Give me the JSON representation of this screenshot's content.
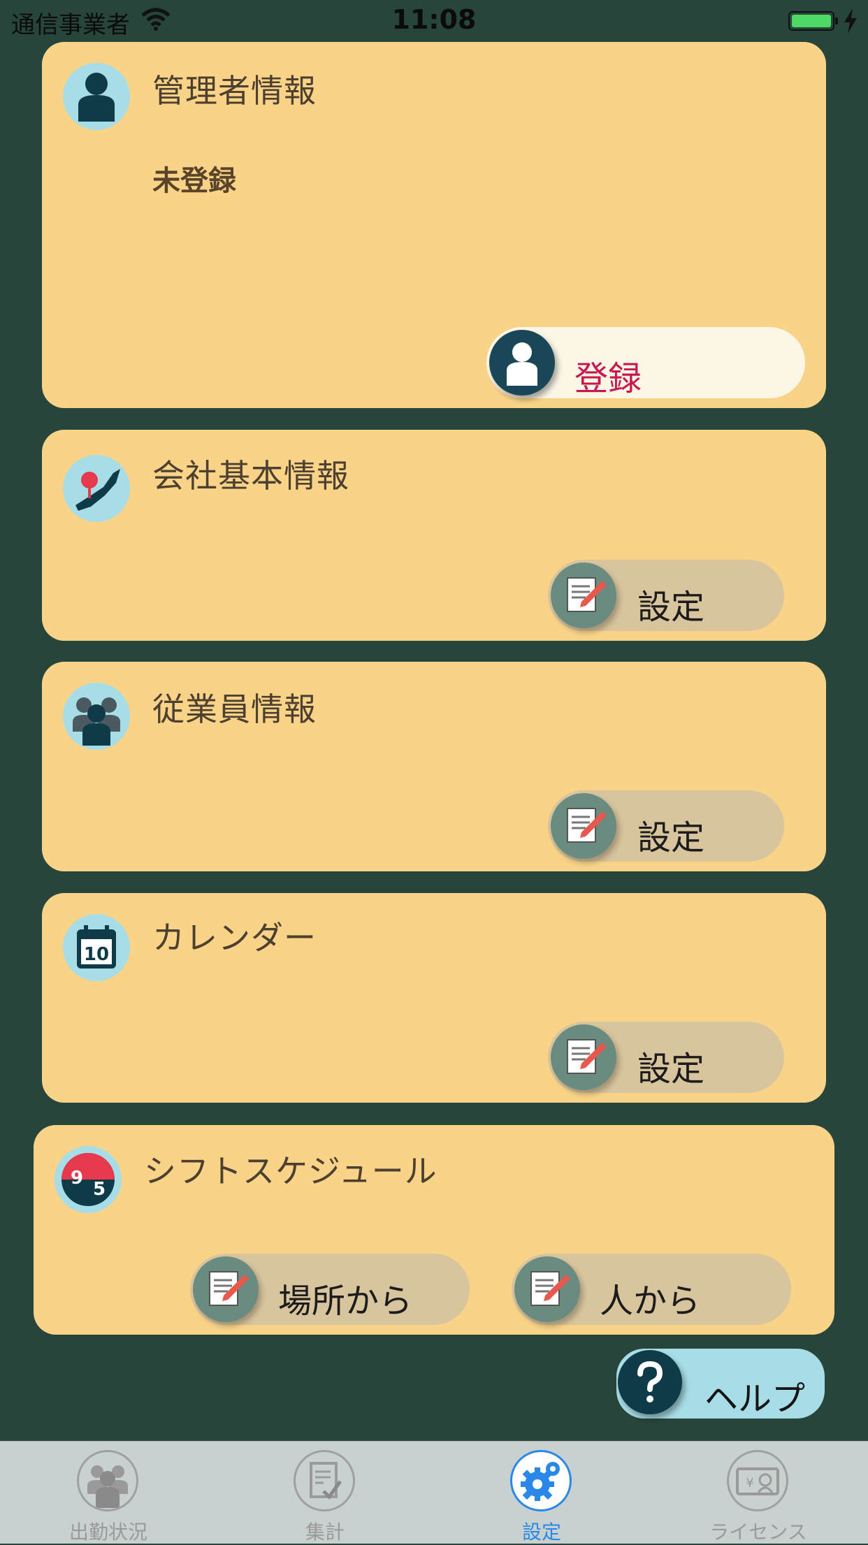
{
  "status_bar": {
    "carrier": "通信事業者",
    "time": "11:08"
  },
  "admin_card": {
    "title": "管理者情報",
    "status": "未登録",
    "register_label": "登録"
  },
  "company_card": {
    "title": "会社基本情報",
    "button_label": "設定"
  },
  "employee_card": {
    "title": "従業員情報",
    "button_label": "設定"
  },
  "calendar_card": {
    "title": "カレンダー",
    "button_label": "設定",
    "calendar_day": "10"
  },
  "shift_card": {
    "title": "シフトスケジュール",
    "icon_text_start": "9",
    "icon_text_end": "5",
    "by_place_label": "場所から",
    "by_person_label": "人から"
  },
  "help_label": "ヘルプ",
  "tab_bar": {
    "tabs": [
      {
        "label": "出勤状況",
        "icon": "people-icon"
      },
      {
        "label": "集計",
        "icon": "checklist-icon"
      },
      {
        "label": "設定",
        "icon": "gear-icon"
      },
      {
        "label": "ライセンス",
        "icon": "license-icon"
      }
    ],
    "selected_index": 2
  },
  "colors": {
    "background": "#27453b",
    "card": "#f9d488",
    "button": "#d8c49d",
    "accent": "#2a89e8",
    "register_text": "#c8174f",
    "help_button": "#a7dde6"
  }
}
